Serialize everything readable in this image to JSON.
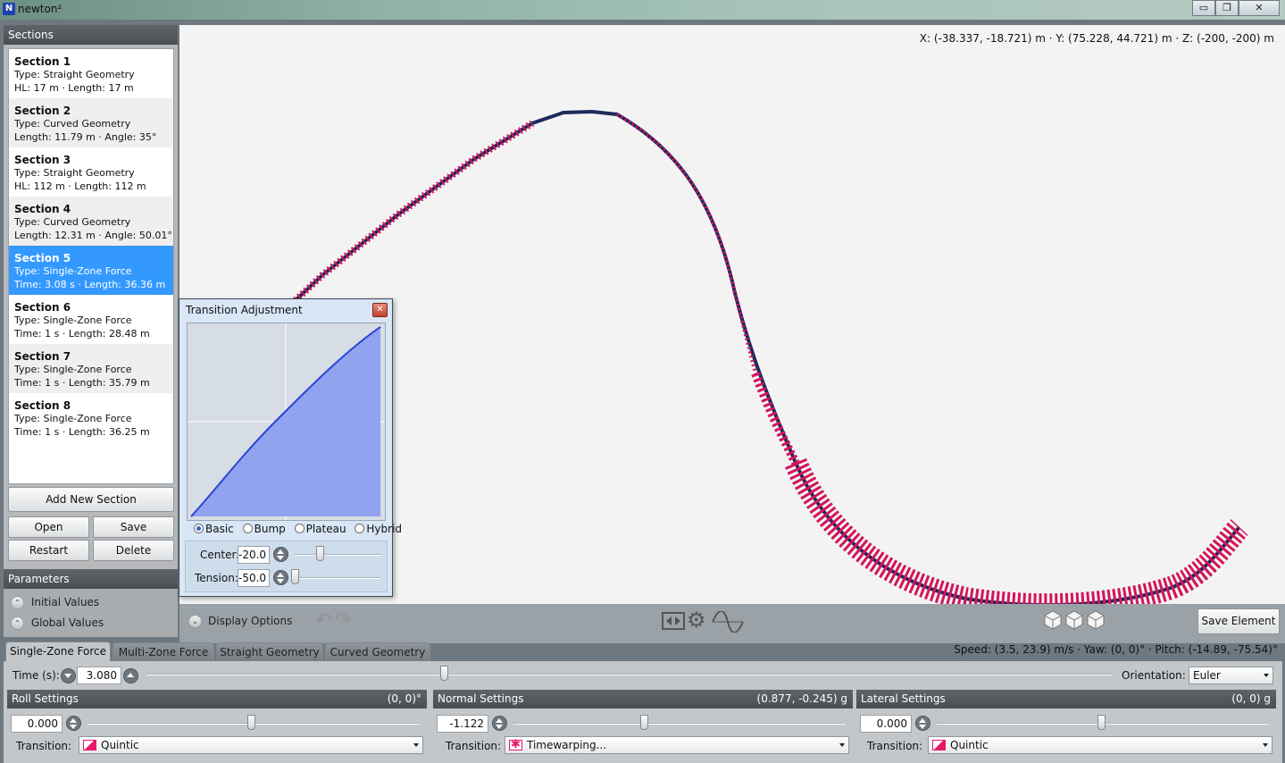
{
  "window": {
    "title": "newton²",
    "logo_letter": "N",
    "controls": [
      "▭",
      "❐",
      "✕"
    ]
  },
  "viewport": {
    "coords": "X: (-38.337, -18.721) m  ·  Y: (75.228, 44.721) m  ·  Z: (-200, -200) m"
  },
  "sections_panel": {
    "title": "Sections",
    "items": [
      {
        "name": "Section 1",
        "type": "Type: Straight Geometry",
        "detail": "HL: 17 m · Length: 17 m"
      },
      {
        "name": "Section 2",
        "type": "Type: Curved Geometry",
        "detail": "Length: 11.79 m · Angle: 35°"
      },
      {
        "name": "Section 3",
        "type": "Type: Straight Geometry",
        "detail": "HL: 112 m · Length: 112 m"
      },
      {
        "name": "Section 4",
        "type": "Type: Curved Geometry",
        "detail": "Length: 12.31 m · Angle: 50.01°"
      },
      {
        "name": "Section 5",
        "type": "Type: Single-Zone Force",
        "detail": "Time: 3.08 s · Length: 36.36 m"
      },
      {
        "name": "Section 6",
        "type": "Type: Single-Zone Force",
        "detail": "Time: 1 s · Length: 28.48 m"
      },
      {
        "name": "Section 7",
        "type": "Type: Single-Zone Force",
        "detail": "Time: 1 s · Length: 35.79 m"
      },
      {
        "name": "Section 8",
        "type": "Type: Single-Zone Force",
        "detail": "Time: 1 s · Length: 36.25 m"
      }
    ],
    "add_label": "Add New Section",
    "open_label": "Open",
    "save_label": "Save",
    "restart_label": "Restart",
    "delete_label": "Delete"
  },
  "parameters_panel": {
    "title": "Parameters",
    "initial_label": "Initial Values",
    "global_label": "Global Values"
  },
  "transition_dialog": {
    "title": "Transition Adjustment",
    "close": "✕",
    "modes": [
      "Basic",
      "Bump",
      "Plateau",
      "Hybrid"
    ],
    "center_label": "Center:",
    "center_value": "-20.0",
    "tension_label": "Tension:",
    "tension_value": "-50.0"
  },
  "toolbar": {
    "display_options": "Display Options",
    "save_element": "Save Element",
    "stats": "Speed: (3.5, 23.9) m/s · Yaw: (0, 0)° · Pitch: (-14.89, -75.54)°"
  },
  "tabs": [
    "Single-Zone Force",
    "Multi-Zone Force",
    "Straight Geometry",
    "Curved Geometry"
  ],
  "time_bar": {
    "label": "Time (s):",
    "value": "3.080",
    "orientation_label": "Orientation:",
    "orientation_value": "Euler"
  },
  "roll": {
    "title": "Roll Settings",
    "range": "(0, 0)°",
    "value": "0.000",
    "transition_label": "Transition:",
    "transition_value": "Quintic"
  },
  "normal": {
    "title": "Normal Settings",
    "range": "(0.877, -0.245) g",
    "value": "-1.122",
    "transition_label": "Transition:",
    "transition_value": "Timewarping..."
  },
  "lateral": {
    "title": "Lateral Settings",
    "range": "(0, 0) g",
    "value": "0.000",
    "transition_label": "Transition:",
    "transition_value": "Quintic"
  },
  "colors": {
    "track_red": "#d4145a",
    "track_navy": "#1d2a5c",
    "selection": "#3399ff",
    "graph_fill": "#8a9cef",
    "graph_line": "#2b44d6"
  }
}
